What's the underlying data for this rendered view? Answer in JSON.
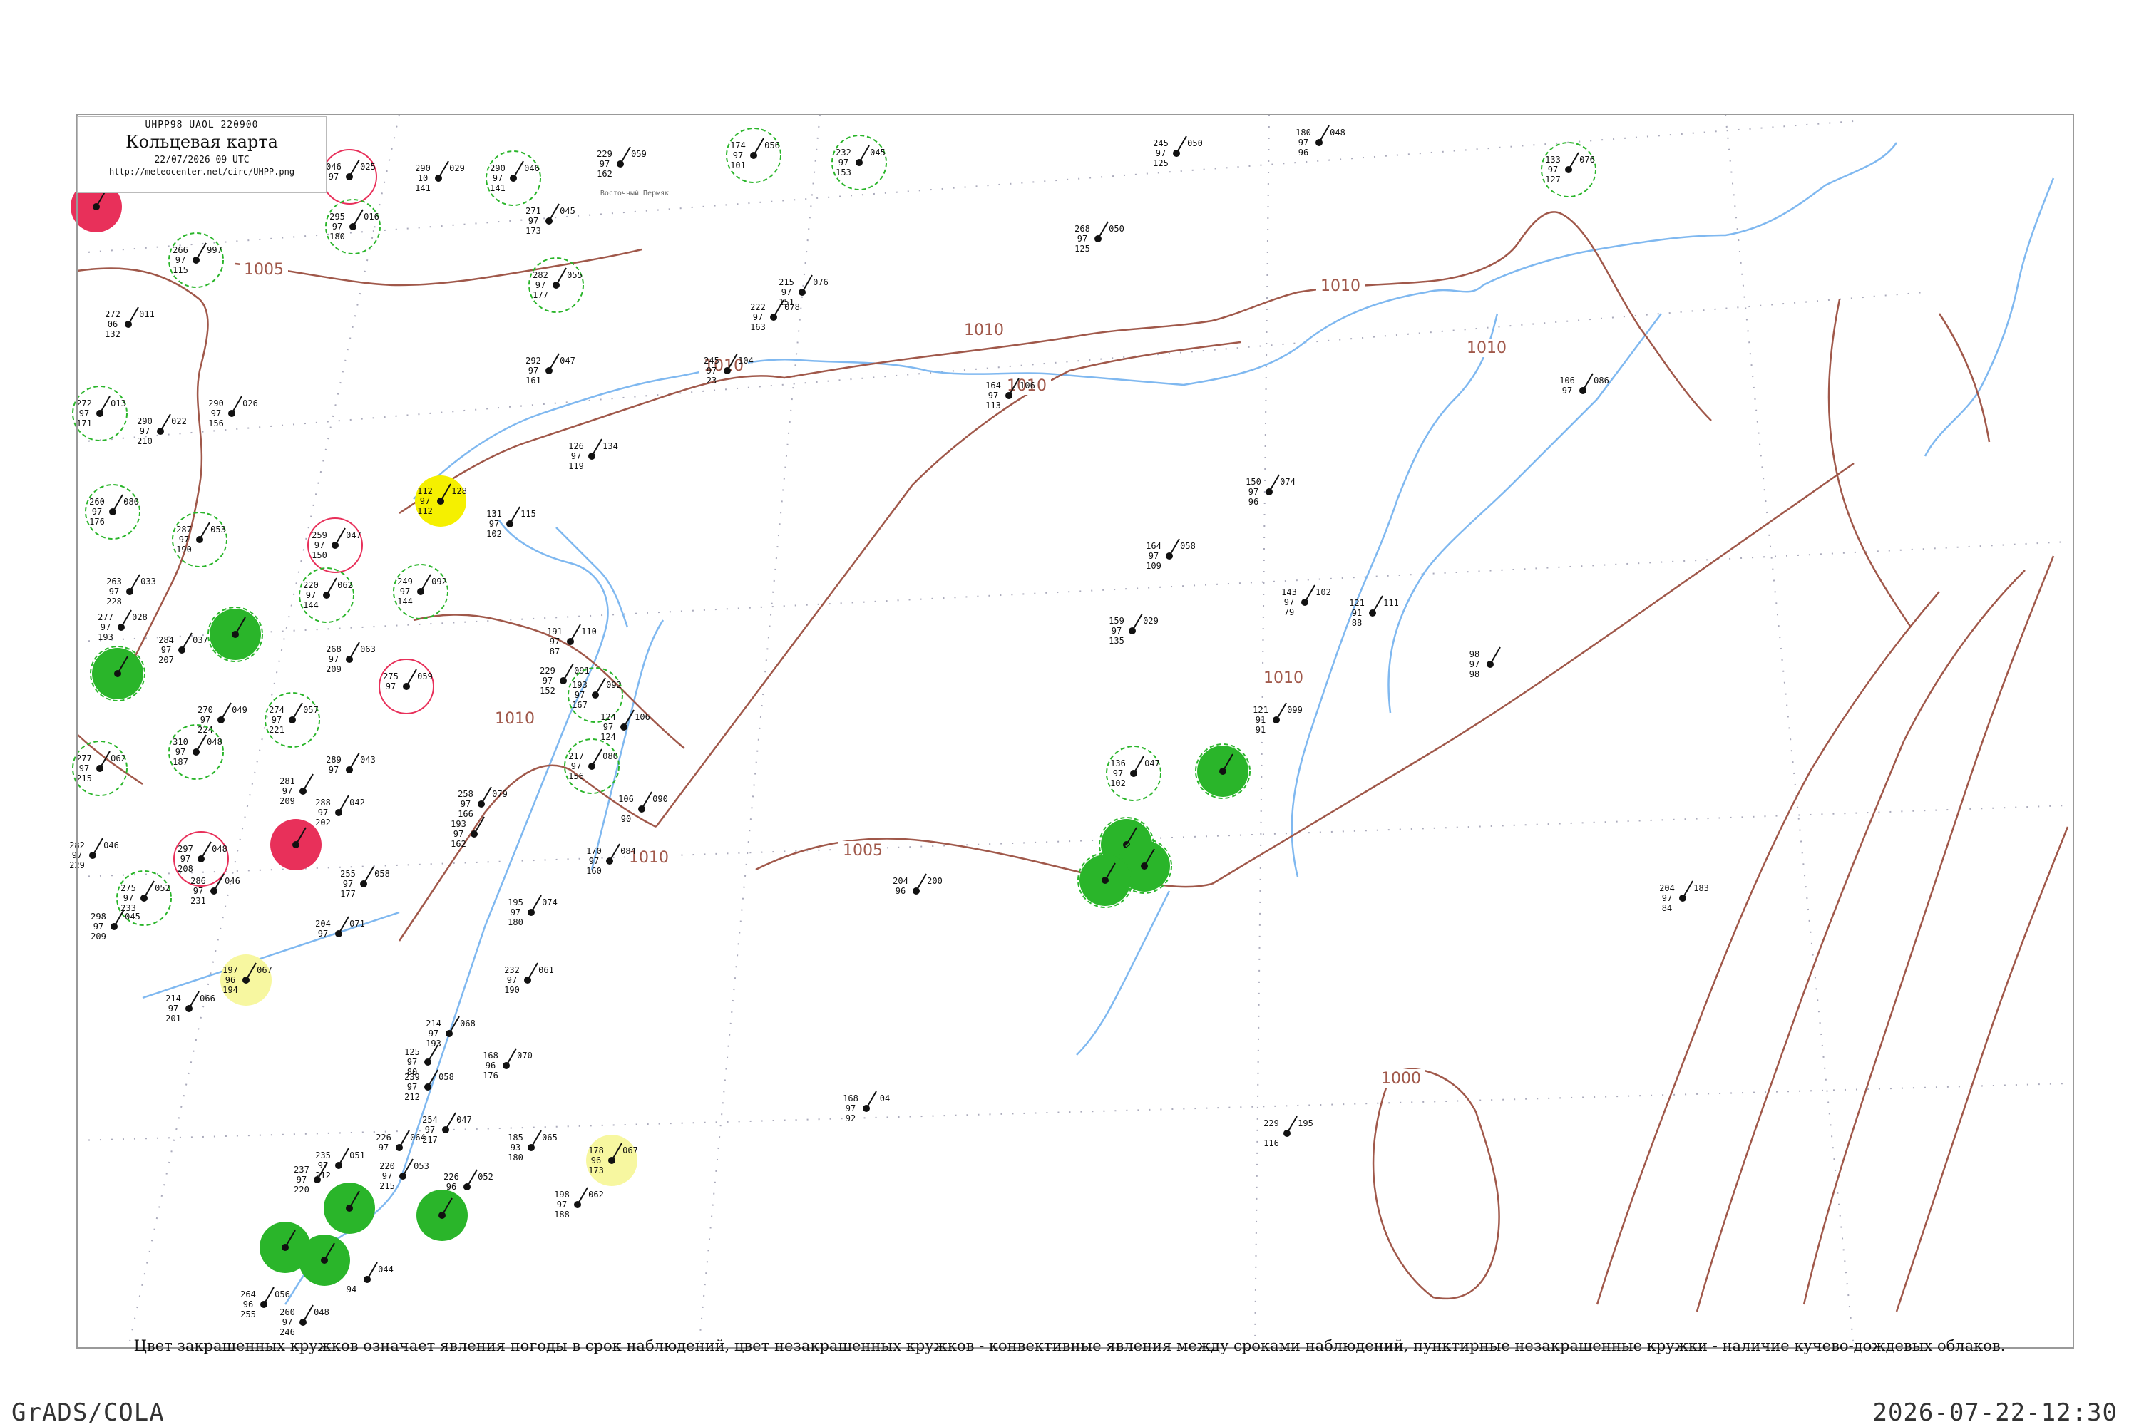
{
  "header": {
    "code": "UHPP98  UAOL  220900",
    "title": "Кольцевая карта",
    "time": "22/07/2026 09 UTC",
    "url": "http://meteocenter.net/circ/UHPP.png"
  },
  "caption": "Цвет закрашенных кружков означает явления погоды в срок наблюдений, цвет незакрашенных кружков - конвективные явления между сроками наблюдений, пунктирные незакрашенные кружки - наличие кучево-дождевых облаков.",
  "footer": {
    "left": "GrADS/COLA",
    "right": "2026-07-22-12:30"
  },
  "colors": {
    "coast": "#7fb8f0",
    "isobar": "#a0584a",
    "convective": "#2ab52a",
    "storm": "#e8305a",
    "fog": "#f5f000",
    "haze": "#f7f7a0",
    "grid": "#aab"
  },
  "isobar_labels": [
    "1005",
    "1010",
    "1010",
    "1010",
    "1010",
    "1010",
    "1010",
    "1005",
    "1010",
    "1000",
    "1010"
  ],
  "stations": [
    {
      "temp": "",
      "pres": "",
      "dew": "",
      "code": "",
      "name": "",
      "fill": "storm",
      "ring": ""
    },
    {
      "temp": "046",
      "pres": "025",
      "dew": "97",
      "code": "",
      "name": "",
      "fill": "",
      "ring": "storm"
    },
    {
      "temp": "290",
      "pres": "029",
      "dew": "10",
      "code": "141",
      "name": "",
      "fill": "",
      "ring": ""
    },
    {
      "temp": "290",
      "pres": "046",
      "dew": "97",
      "code": "141",
      "name": "",
      "fill": "",
      "ring": "dash"
    },
    {
      "temp": "229",
      "pres": "059",
      "dew": "97",
      "code": "162",
      "name": "Восточный Пермяк",
      "fill": "",
      "ring": ""
    },
    {
      "temp": "174",
      "pres": "056",
      "dew": "97",
      "code": "101",
      "name": "",
      "fill": "",
      "ring": "dash"
    },
    {
      "temp": "232",
      "pres": "045",
      "dew": "97",
      "code": "153",
      "name": "",
      "fill": "",
      "ring": "dash"
    },
    {
      "temp": "245",
      "pres": "050",
      "dew": "97",
      "code": "125",
      "name": "",
      "fill": "",
      "ring": ""
    },
    {
      "temp": "180",
      "pres": "048",
      "dew": "97",
      "code": "96",
      "name": "",
      "fill": "",
      "ring": ""
    },
    {
      "temp": "133",
      "pres": "076",
      "dew": "97",
      "code": "127",
      "name": "",
      "fill": "",
      "ring": "dash"
    },
    {
      "temp": "295",
      "pres": "016",
      "dew": "97",
      "code": "180",
      "name": "",
      "fill": "",
      "ring": "dash"
    },
    {
      "temp": "266",
      "pres": "997",
      "dew": "97",
      "code": "115",
      "name": "",
      "fill": "",
      "ring": "dash"
    },
    {
      "temp": "271",
      "pres": "045",
      "dew": "97",
      "code": "173",
      "name": "",
      "fill": "",
      "ring": ""
    },
    {
      "temp": "282",
      "pres": "055",
      "dew": "97",
      "code": "177",
      "name": "",
      "fill": "",
      "ring": "dash"
    },
    {
      "temp": "268",
      "pres": "050",
      "dew": "97",
      "code": "125",
      "name": "",
      "fill": "",
      "ring": ""
    },
    {
      "temp": "215",
      "pres": "076",
      "dew": "97",
      "code": "151",
      "name": "",
      "fill": "",
      "ring": ""
    },
    {
      "temp": "222",
      "pres": "078",
      "dew": "97",
      "code": "163",
      "name": "",
      "fill": "",
      "ring": ""
    },
    {
      "temp": "272",
      "pres": "011",
      "dew": "06",
      "code": "132",
      "name": "",
      "fill": "",
      "ring": ""
    },
    {
      "temp": "292",
      "pres": "047",
      "dew": "97",
      "code": "161",
      "name": "",
      "fill": "",
      "ring": ""
    },
    {
      "temp": "245",
      "pres": "104",
      "dew": "97",
      "code": "23",
      "name": "",
      "fill": "",
      "ring": ""
    },
    {
      "temp": "164",
      "pres": "106",
      "dew": "97",
      "code": "113",
      "name": "",
      "fill": "",
      "ring": ""
    },
    {
      "temp": "106",
      "pres": "086",
      "dew": "97",
      "code": "",
      "name": "",
      "fill": "",
      "ring": ""
    },
    {
      "temp": "272",
      "pres": "013",
      "dew": "97",
      "code": "171",
      "name": "",
      "fill": "",
      "ring": "dash"
    },
    {
      "temp": "290",
      "pres": "022",
      "dew": "97",
      "code": "210",
      "name": "",
      "fill": "",
      "ring": ""
    },
    {
      "temp": "290",
      "pres": "026",
      "dew": "97",
      "code": "156",
      "name": "",
      "fill": "",
      "ring": ""
    },
    {
      "temp": "126",
      "pres": "134",
      "dew": "97",
      "code": "119",
      "name": "",
      "fill": "",
      "ring": ""
    },
    {
      "temp": "112",
      "pres": "128",
      "dew": "97",
      "code": "112",
      "name": "",
      "fill": "fog",
      "ring": ""
    },
    {
      "temp": "131",
      "pres": "115",
      "dew": "97",
      "code": "102",
      "name": "",
      "fill": "",
      "ring": ""
    },
    {
      "temp": "150",
      "pres": "074",
      "dew": "97",
      "code": "96",
      "name": "",
      "fill": "",
      "ring": ""
    },
    {
      "temp": "260",
      "pres": "080",
      "dew": "97",
      "code": "176",
      "name": "",
      "fill": "",
      "ring": "dash"
    },
    {
      "temp": "287",
      "pres": "053",
      "dew": "97",
      "code": "190",
      "name": "",
      "fill": "",
      "ring": "dash"
    },
    {
      "temp": "259",
      "pres": "047",
      "dew": "97",
      "code": "150",
      "name": "",
      "fill": "",
      "ring": "storm"
    },
    {
      "temp": "164",
      "pres": "058",
      "dew": "97",
      "code": "109",
      "name": "",
      "fill": "",
      "ring": ""
    },
    {
      "temp": "263",
      "pres": "033",
      "dew": "97",
      "code": "228",
      "name": "",
      "fill": "",
      "ring": ""
    },
    {
      "temp": "220",
      "pres": "062",
      "dew": "97",
      "code": "144",
      "name": "",
      "fill": "",
      "ring": "dash"
    },
    {
      "temp": "249",
      "pres": "092",
      "dew": "97",
      "code": "144",
      "name": "",
      "fill": "",
      "ring": "dash"
    },
    {
      "temp": "143",
      "pres": "102",
      "dew": "97",
      "code": "79",
      "name": "",
      "fill": "",
      "ring": ""
    },
    {
      "temp": "121",
      "pres": "111",
      "dew": "91",
      "code": "88",
      "name": "",
      "fill": "",
      "ring": ""
    },
    {
      "temp": "277",
      "pres": "028",
      "dew": "97",
      "code": "193",
      "name": "",
      "fill": "",
      "ring": ""
    },
    {
      "temp": "",
      "pres": "",
      "dew": "",
      "code": "",
      "name": "",
      "fill": "conv",
      "ring": "dash"
    },
    {
      "temp": "284",
      "pres": "037",
      "dew": "97",
      "code": "207",
      "name": "",
      "fill": "",
      "ring": ""
    },
    {
      "temp": "191",
      "pres": "110",
      "dew": "97",
      "code": "87",
      "name": "",
      "fill": "",
      "ring": ""
    },
    {
      "temp": "159",
      "pres": "029",
      "dew": "97",
      "code": "135",
      "name": "",
      "fill": "",
      "ring": ""
    },
    {
      "temp": "",
      "pres": "",
      "dew": "",
      "code": "",
      "name": "",
      "fill": "conv",
      "ring": "dash"
    },
    {
      "temp": "268",
      "pres": "063",
      "dew": "97",
      "code": "209",
      "name": "",
      "fill": "",
      "ring": ""
    },
    {
      "temp": "275",
      "pres": "059",
      "dew": "97",
      "code": "",
      "name": "",
      "fill": "",
      "ring": "storm"
    },
    {
      "temp": "229",
      "pres": "091",
      "dew": "97",
      "code": "152",
      "name": "",
      "fill": "",
      "ring": ""
    },
    {
      "temp": "193",
      "pres": "092",
      "dew": "97",
      "code": "167",
      "name": "",
      "fill": "",
      "ring": "dash"
    },
    {
      "temp": "98",
      "pres": "",
      "dew": "97",
      "code": "98",
      "name": "",
      "fill": "",
      "ring": ""
    },
    {
      "temp": "270",
      "pres": "049",
      "dew": "97",
      "code": "224",
      "name": "",
      "fill": "",
      "ring": ""
    },
    {
      "temp": "274",
      "pres": "057",
      "dew": "97",
      "code": "221",
      "name": "",
      "fill": "",
      "ring": "dash"
    },
    {
      "temp": "124",
      "pres": "106",
      "dew": "97",
      "code": "124",
      "name": "",
      "fill": "",
      "ring": ""
    },
    {
      "temp": "121",
      "pres": "099",
      "dew": "91",
      "code": "91",
      "name": "",
      "fill": "",
      "ring": ""
    },
    {
      "temp": "310",
      "pres": "048",
      "dew": "97",
      "code": "187",
      "name": "",
      "fill": "",
      "ring": "dash"
    },
    {
      "temp": "277",
      "pres": "062",
      "dew": "97",
      "code": "215",
      "name": "",
      "fill": "",
      "ring": "dash"
    },
    {
      "temp": "289",
      "pres": "043",
      "dew": "97",
      "code": "",
      "name": "",
      "fill": "",
      "ring": ""
    },
    {
      "temp": "217",
      "pres": "080",
      "dew": "97",
      "code": "156",
      "name": "",
      "fill": "",
      "ring": "dash"
    },
    {
      "temp": "136",
      "pres": "047",
      "dew": "97",
      "code": "102",
      "name": "",
      "fill": "",
      "ring": "dash"
    },
    {
      "temp": "",
      "pres": "",
      "dew": "",
      "code": "",
      "name": "",
      "fill": "conv",
      "ring": "dash"
    },
    {
      "temp": "281",
      "pres": "",
      "dew": "97",
      "code": "209",
      "name": "",
      "fill": "",
      "ring": ""
    },
    {
      "temp": "258",
      "pres": "079",
      "dew": "97",
      "code": "166",
      "name": "",
      "fill": "",
      "ring": ""
    },
    {
      "temp": "106",
      "pres": "090",
      "dew": "",
      "code": "90",
      "name": "",
      "fill": "",
      "ring": ""
    },
    {
      "temp": "288",
      "pres": "042",
      "dew": "97",
      "code": "202",
      "name": "",
      "fill": "",
      "ring": ""
    },
    {
      "temp": "193",
      "pres": "",
      "dew": "97",
      "code": "162",
      "name": "",
      "fill": "",
      "ring": ""
    },
    {
      "temp": "282",
      "pres": "046",
      "dew": "97",
      "code": "229",
      "name": "",
      "fill": "",
      "ring": ""
    },
    {
      "temp": "",
      "pres": "",
      "dew": "",
      "code": "",
      "name": "",
      "fill": "storm",
      "ring": ""
    },
    {
      "temp": "297",
      "pres": "048",
      "dew": "97",
      "code": "208",
      "name": "",
      "fill": "",
      "ring": "storm"
    },
    {
      "temp": "170",
      "pres": "084",
      "dew": "97",
      "code": "160",
      "name": "",
      "fill": "",
      "ring": ""
    },
    {
      "temp": "",
      "pres": "",
      "dew": "",
      "code": "",
      "name": "",
      "fill": "conv",
      "ring": "dash"
    },
    {
      "temp": "",
      "pres": "",
      "dew": "",
      "code": "",
      "name": "",
      "fill": "conv",
      "ring": "dash"
    },
    {
      "temp": "",
      "pres": "",
      "dew": "",
      "code": "",
      "name": "",
      "fill": "conv",
      "ring": "dash"
    },
    {
      "temp": "275",
      "pres": "052",
      "dew": "97",
      "code": "233",
      "name": "",
      "fill": "",
      "ring": "dash"
    },
    {
      "temp": "286",
      "pres": "046",
      "dew": "97",
      "code": "231",
      "name": "",
      "fill": "",
      "ring": ""
    },
    {
      "temp": "255",
      "pres": "058",
      "dew": "97",
      "code": "177",
      "name": "",
      "fill": "",
      "ring": ""
    },
    {
      "temp": "195",
      "pres": "074",
      "dew": "97",
      "code": "180",
      "name": "",
      "fill": "",
      "ring": ""
    },
    {
      "temp": "204",
      "pres": "200",
      "dew": "96",
      "code": "",
      "name": "",
      "fill": "",
      "ring": ""
    },
    {
      "temp": "204",
      "pres": "183",
      "dew": "97",
      "code": "84",
      "name": "",
      "fill": "",
      "ring": ""
    },
    {
      "temp": "298",
      "pres": "045",
      "dew": "97",
      "code": "209",
      "name": "",
      "fill": "",
      "ring": ""
    },
    {
      "temp": "204",
      "pres": "071",
      "dew": "97",
      "code": "",
      "name": "",
      "fill": "",
      "ring": ""
    },
    {
      "temp": "197",
      "pres": "067",
      "dew": "96",
      "code": "194",
      "name": "",
      "fill": "haze",
      "ring": ""
    },
    {
      "temp": "232",
      "pres": "061",
      "dew": "97",
      "code": "190",
      "name": "",
      "fill": "",
      "ring": ""
    },
    {
      "temp": "214",
      "pres": "066",
      "dew": "97",
      "code": "201",
      "name": "",
      "fill": "",
      "ring": ""
    },
    {
      "temp": "214",
      "pres": "068",
      "dew": "97",
      "code": "193",
      "name": "",
      "fill": "",
      "ring": ""
    },
    {
      "temp": "125",
      "pres": "",
      "dew": "97",
      "code": "80",
      "name": "",
      "fill": "",
      "ring": ""
    },
    {
      "temp": "168",
      "pres": "070",
      "dew": "96",
      "code": "176",
      "name": "",
      "fill": "",
      "ring": ""
    },
    {
      "temp": "168",
      "pres": "04",
      "dew": "97",
      "code": "92",
      "name": "",
      "fill": "",
      "ring": ""
    },
    {
      "temp": "229",
      "pres": "195",
      "dew": "",
      "code": "116",
      "name": "",
      "fill": "",
      "ring": ""
    },
    {
      "temp": "239",
      "pres": "058",
      "dew": "97",
      "code": "212",
      "name": "",
      "fill": "",
      "ring": ""
    },
    {
      "temp": "254",
      "pres": "047",
      "dew": "97",
      "code": "217",
      "name": "",
      "fill": "",
      "ring": ""
    },
    {
      "temp": "185",
      "pres": "065",
      "dew": "93",
      "code": "180",
      "name": "",
      "fill": "",
      "ring": ""
    },
    {
      "temp": "178",
      "pres": "067",
      "dew": "96",
      "code": "173",
      "name": "",
      "fill": "haze",
      "ring": ""
    },
    {
      "temp": "235",
      "pres": "051",
      "dew": "97",
      "code": "212",
      "name": "",
      "fill": "",
      "ring": ""
    },
    {
      "temp": "226",
      "pres": "064",
      "dew": "97",
      "code": "",
      "name": "",
      "fill": "",
      "ring": ""
    },
    {
      "temp": "220",
      "pres": "053",
      "dew": "97",
      "code": "215",
      "name": "",
      "fill": "",
      "ring": ""
    },
    {
      "temp": "226",
      "pres": "052",
      "dew": "96",
      "code": "",
      "name": "",
      "fill": "",
      "ring": ""
    },
    {
      "temp": "198",
      "pres": "062",
      "dew": "97",
      "code": "188",
      "name": "",
      "fill": "",
      "ring": ""
    },
    {
      "temp": "237",
      "pres": "",
      "dew": "97",
      "code": "220",
      "name": "",
      "fill": "",
      "ring": ""
    },
    {
      "temp": "",
      "pres": "",
      "dew": "",
      "code": "",
      "name": "",
      "fill": "conv",
      "ring": ""
    },
    {
      "temp": "",
      "pres": "",
      "dew": "",
      "code": "",
      "name": "",
      "fill": "conv",
      "ring": ""
    },
    {
      "temp": "",
      "pres": "",
      "dew": "",
      "code": "",
      "name": "",
      "fill": "conv",
      "ring": ""
    },
    {
      "temp": "",
      "pres": "",
      "dew": "",
      "code": "",
      "name": "",
      "fill": "conv",
      "ring": ""
    },
    {
      "temp": "",
      "pres": "044",
      "dew": "",
      "code": "94",
      "name": "",
      "fill": "",
      "ring": ""
    },
    {
      "temp": "264",
      "pres": "056",
      "dew": "96",
      "code": "255",
      "name": "",
      "fill": "",
      "ring": ""
    },
    {
      "temp": "260",
      "pres": "048",
      "dew": "97",
      "code": "246",
      "name": "",
      "fill": "",
      "ring": ""
    }
  ]
}
